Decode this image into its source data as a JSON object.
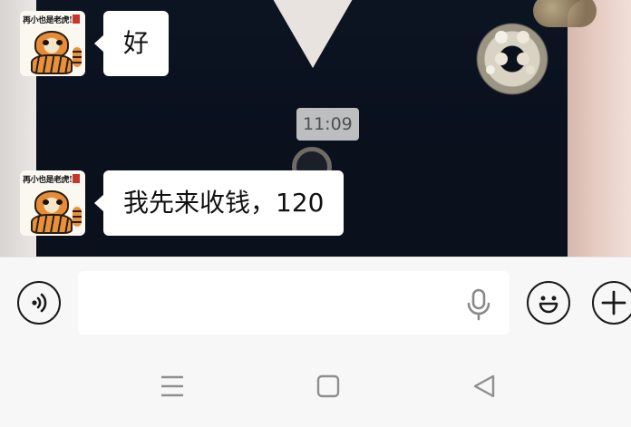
{
  "chat": {
    "messages": [
      {
        "sender_avatar": "tiger-avatar",
        "avatar_caption": "再小也是老虎!",
        "text": "好"
      },
      {
        "sender_avatar": "tiger-avatar",
        "avatar_caption": "再小也是老虎!",
        "text": "我先来收钱，120"
      }
    ],
    "timestamp": "11:09",
    "bubble_color": "#ffffff",
    "timestamp_bg": "#cdcdcd"
  },
  "input_bar": {
    "voice_icon": "voice-icon",
    "text_value": "",
    "mic_icon": "microphone-icon",
    "emoji_icon": "emoji-icon",
    "plus_icon": "plus-icon"
  },
  "nav_bar": {
    "menu_icon": "menu-icon",
    "home_icon": "home-square-icon",
    "back_icon": "back-triangle-icon"
  }
}
